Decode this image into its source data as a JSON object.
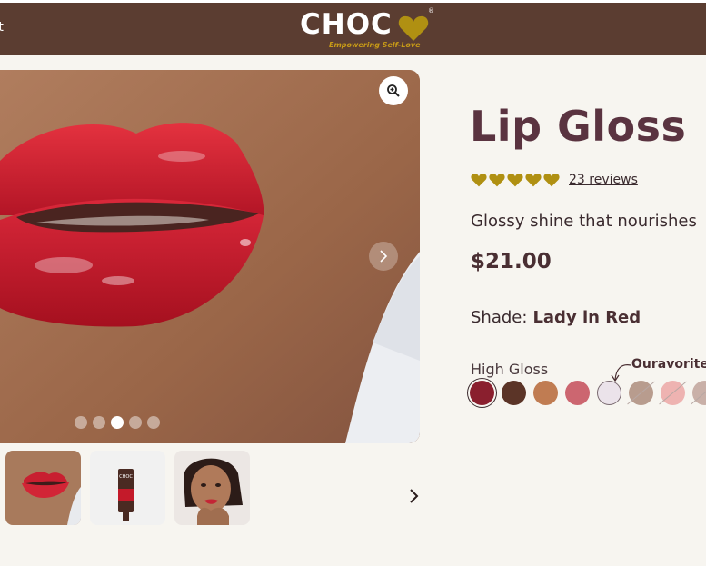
{
  "header": {
    "nav_label": "ort",
    "logo_text": "CHOC",
    "logo_registered": "®",
    "logo_tagline": "Empowering Self-Love"
  },
  "gallery": {
    "slide_count": 5,
    "active_slide": 3
  },
  "product": {
    "title": "Lip Gloss",
    "rating": 5,
    "reviews_text": "23 reviews",
    "description": "Glossy shine that nourishes",
    "price": "$21.00",
    "shade_label": "Shade:",
    "shade_value": "Lady in Red",
    "finish_label": "High Gloss",
    "favorite_label": "Ouravorite"
  },
  "swatches": [
    {
      "color": "#8a1f2e",
      "selected": true,
      "available": true
    },
    {
      "color": "#5b3427",
      "selected": false,
      "available": true
    },
    {
      "color": "#c07c52",
      "selected": false,
      "available": true
    },
    {
      "color": "#cc6670",
      "selected": false,
      "available": true
    },
    {
      "color": "#ebe3ea",
      "selected": false,
      "available": true
    },
    {
      "color": "#b89c8e",
      "selected": false,
      "available": false
    },
    {
      "color": "#eeb3b1",
      "selected": false,
      "available": false
    },
    {
      "color": "#c9b0a8",
      "selected": false,
      "available": false
    }
  ],
  "colors": {
    "header_bg": "#5b3d31",
    "accent_gold": "#b09012",
    "title": "#5a3340"
  }
}
